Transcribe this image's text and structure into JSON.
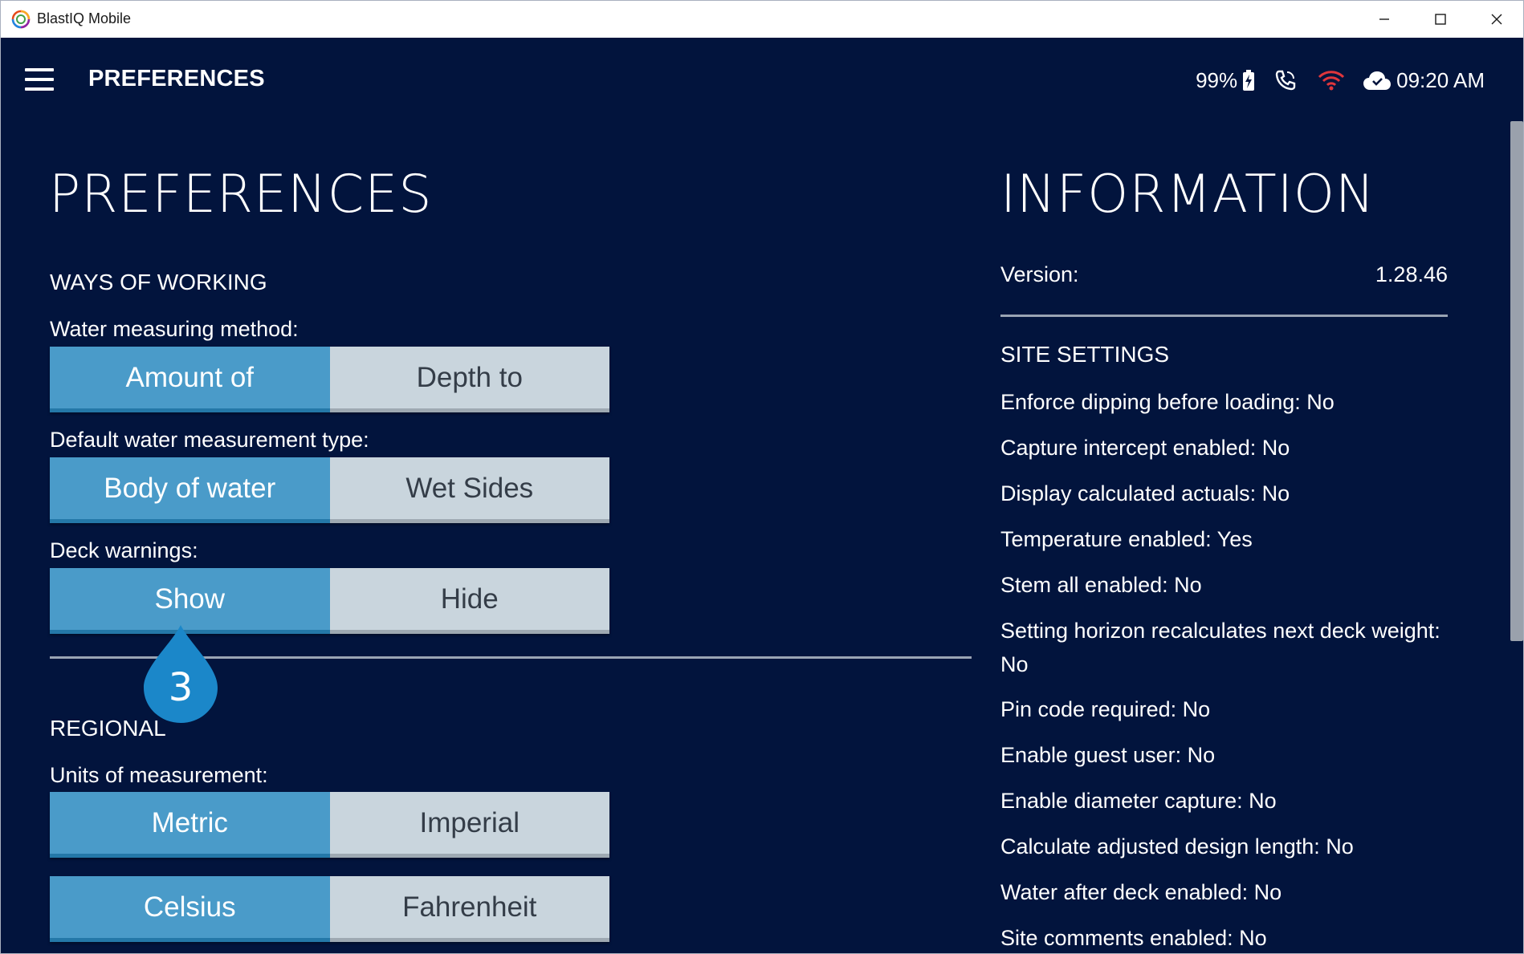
{
  "window": {
    "title": "BlastIQ Mobile"
  },
  "appbar": {
    "title": "PREFERENCES",
    "status": {
      "battery": "99%",
      "time": "09:20 AM"
    }
  },
  "preferences": {
    "heading": "PREFERENCES",
    "ways_of_working": {
      "title": "WAYS OF WORKING",
      "water_method_label": "Water measuring method:",
      "water_method": [
        "Amount of",
        "Depth to"
      ],
      "water_type_label": "Default water measurement type:",
      "water_type": [
        "Body of water",
        "Wet Sides"
      ],
      "deck_warnings_label": "Deck warnings:",
      "deck_warnings": [
        "Show",
        "Hide"
      ]
    },
    "badge": "3",
    "regional": {
      "title": "REGIONAL",
      "units_label": "Units of measurement:",
      "units": [
        "Metric",
        "Imperial"
      ],
      "temperature": [
        "Celsius",
        "Fahrenheit"
      ]
    }
  },
  "information": {
    "heading": "INFORMATION",
    "version_label": "Version:",
    "version_value": "1.28.46",
    "site_settings_title": "SITE SETTINGS",
    "settings": [
      "Enforce dipping before loading: No",
      "Capture intercept enabled: No",
      "Display calculated actuals: No",
      "Temperature enabled: Yes",
      "Stem all enabled: No",
      "Setting horizon recalculates next deck weight:",
      "No",
      "Pin code required: No",
      "Enable guest user: No",
      "Enable diameter capture: No",
      "Calculate adjusted design length: No",
      "Water after deck enabled: No",
      "Site comments enabled: No"
    ]
  },
  "colors": {
    "background": "#02143d",
    "selected": "#4a9bc9",
    "unselected": "#c9d5dd",
    "badge": "#1b87c9",
    "wifi": "#e0363c"
  }
}
